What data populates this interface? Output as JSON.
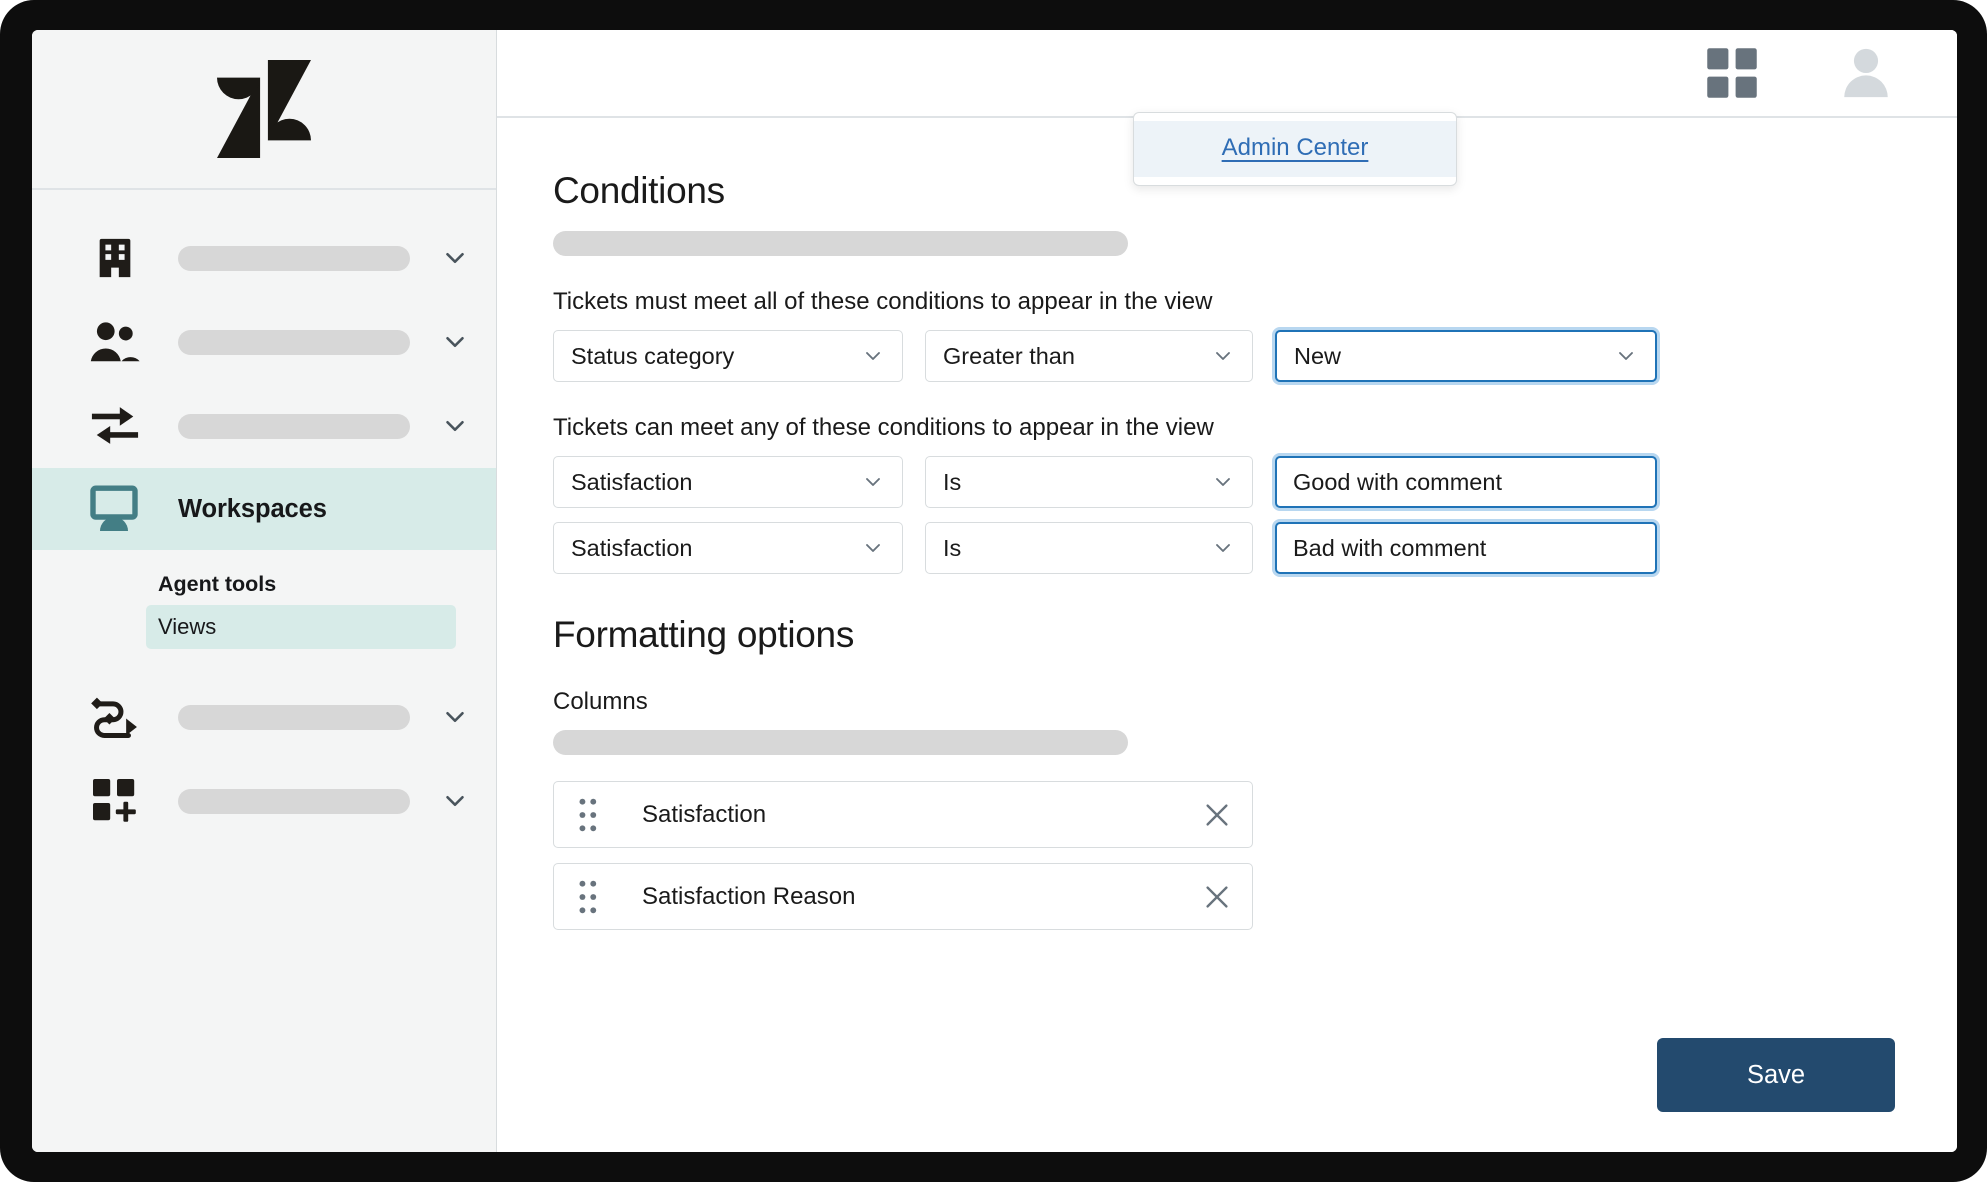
{
  "app": {
    "logo_name": "zendesk-logo",
    "brand_dark": "#1f1c18",
    "accent_teal": "#437e85",
    "accent_blue": "#1f73b7",
    "save_navy": "#234a6e"
  },
  "topbar": {
    "grid_icon": "grid-apps-icon",
    "avatar_icon": "user-avatar-icon",
    "menu": {
      "item_label": "Admin Center"
    }
  },
  "sidebar": {
    "items": [
      {
        "icon": "building-icon",
        "label": "",
        "has_chevron": true,
        "active": false
      },
      {
        "icon": "people-icon",
        "label": "",
        "has_chevron": true,
        "active": false
      },
      {
        "icon": "transfer-arrows-icon",
        "label": "",
        "has_chevron": true,
        "active": false
      },
      {
        "icon": "monitor-icon",
        "label": "Workspaces",
        "has_chevron": false,
        "active": true
      },
      {
        "icon": "workflow-icon",
        "label": "",
        "has_chevron": true,
        "active": false
      },
      {
        "icon": "apps-add-icon",
        "label": "",
        "has_chevron": true,
        "active": false
      }
    ],
    "subnav": {
      "header": "Agent tools",
      "items": [
        {
          "label": "Views",
          "selected": true
        }
      ]
    }
  },
  "content": {
    "conditions": {
      "title": "Conditions",
      "all_legend": "Tickets must meet all of these conditions to appear in the view",
      "any_legend": "Tickets can meet any of these conditions to appear in the view",
      "all_rows": [
        {
          "field": "Status category",
          "operator": "Greater than",
          "value": "New",
          "value_type": "select",
          "value_focused": true
        }
      ],
      "any_rows": [
        {
          "field": "Satisfaction",
          "operator": "Is",
          "value": "Good with comment",
          "value_type": "text",
          "value_focused": true
        },
        {
          "field": "Satisfaction",
          "operator": "Is",
          "value": "Bad with comment",
          "value_type": "text",
          "value_focused": true
        }
      ]
    },
    "formatting": {
      "title": "Formatting options",
      "columns_label": "Columns",
      "columns": [
        {
          "label": "Satisfaction",
          "drag_icon": "drag-handle-icon",
          "remove_icon": "close-icon"
        },
        {
          "label": "Satisfaction Reason",
          "drag_icon": "drag-handle-icon",
          "remove_icon": "close-icon"
        }
      ]
    },
    "save_label": "Save"
  }
}
